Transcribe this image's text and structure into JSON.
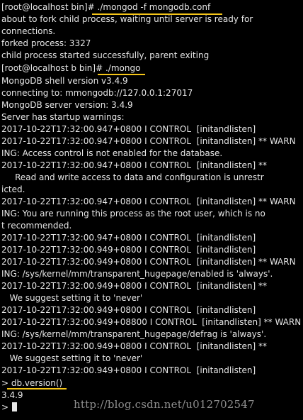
{
  "terminal": {
    "lines": [
      "[root@localhost bin]# ./mongod -f mongodb.conf",
      "about to fork child process, waiting until server is ready for",
      "connections.",
      "forked process: 3327",
      "child process started successfully, parent exiting",
      "[root@localhost b bin]# ./mongo",
      "MongoDB shell version v3.4.9",
      "connecting to: mmongodb://127.0.0.1:27017",
      "MongoDB server version: 3.4.9",
      "Server has startup warnings:",
      "2017-10-22T17:32:00.947+0800 I CONTROL  [initandlisten]",
      "2017-10-22T17:32:00.947+0800 I CONTROL  [initandlisten] ** WARN",
      "ING: Access control is not enabled for the database.",
      "2017-10-22T17:32:00.947+0800 I CONTROL  [initandlisten] **",
      "     Read and write access to data and configuration is unrestr",
      "icted.",
      "2017-10-22T17:32:00.947+0800 I CONTROL  [initandlisten] ** WARN",
      "ING: You are running this process as the root user, which is no",
      "t recommended.",
      "2017-10-22T17:32:00.947+0800 I CONTROL  [initandlisten]",
      "2017-10-22T17:32:00.949+0800 I CONTROL  [initandlisten]",
      "2017-10-22T17:32:00.949+0800 I CONTROL  [initandlisten] ** WARN",
      "ING: /sys/kernel/mm/transparent_hugepage/enabled is 'always'.",
      "2017-10-22T17:32:00.949+0800 I CONTROL  [initandlisten] **",
      "   We suggest setting it to 'never'",
      "2017-10-22T17:32:00.949+0800 I CONTROL  [initandlisten]",
      "2017-10-22T17:32:00.949+08800 I CONTROL  [initandlisten] ** WARN",
      "ING: /sys/kernel/mm/transparent_hugepage/defrag is 'always'.",
      "2017-10-22T17:32:00.949+0800 I CONTROL  [initandlisten] **",
      "   We suggest setting it to 'never'",
      "2017-10-22T17:32:00.949+0800 I CONTROL  [initandlisten]",
      "> db.version()",
      "3.4.9",
      ">"
    ],
    "watermark": "http://blog.csdn.net/u012702547",
    "highlight_color": "#f5c518",
    "background_color": "#000000",
    "text_color": "#e6e6e6"
  }
}
